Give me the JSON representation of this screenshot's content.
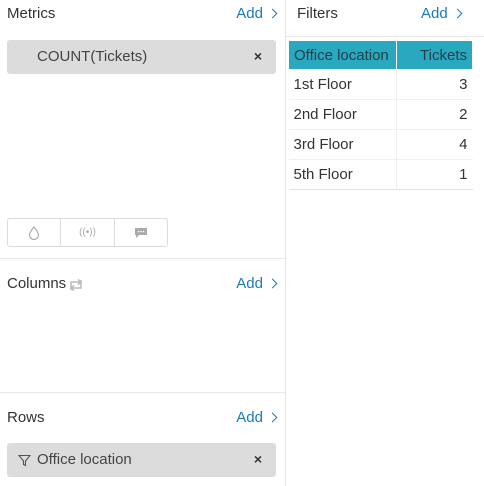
{
  "metrics": {
    "title": "Metrics",
    "add_label": "Add",
    "items": [
      {
        "label": "COUNT(Tickets)",
        "remove": "×"
      }
    ],
    "viz_options": [
      {
        "icon": "droplet-icon",
        "glyph": "◊"
      },
      {
        "icon": "broadcast-icon",
        "glyph": "((•))"
      },
      {
        "icon": "comment-icon",
        "glyph": "▬"
      }
    ]
  },
  "columns": {
    "title": "Columns",
    "add_label": "Add",
    "swap_icon": "swap-icon"
  },
  "rows": {
    "title": "Rows",
    "add_label": "Add",
    "items": [
      {
        "label": "Office location",
        "remove": "×",
        "icon": "filter-icon"
      }
    ]
  },
  "filters": {
    "title": "Filters",
    "add_label": "Add"
  },
  "table": {
    "headers": [
      "Office location",
      "Tickets"
    ],
    "rows": [
      [
        "1st Floor",
        "3"
      ],
      [
        "2nd Floor",
        "2"
      ],
      [
        "3rd Floor",
        "4"
      ],
      [
        "5th Floor",
        "1"
      ]
    ]
  },
  "colors": {
    "accent": "#1a7bb9",
    "header_bg": "#2aa8bf",
    "pill_bg": "#dcdcdc"
  }
}
